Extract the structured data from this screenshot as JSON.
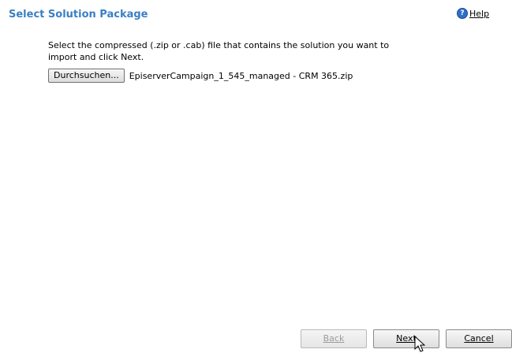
{
  "header": {
    "title": "Select Solution Package",
    "help_label": "Help",
    "help_icon": "help-icon"
  },
  "main": {
    "instructions": "Select the compressed (.zip or .cab) file that contains the solution you want to import and click Next.",
    "browse_label": "Durchsuchen...",
    "file_name": "EpiserverCampaign_1_545_managed - CRM 365.zip"
  },
  "footer": {
    "back_label": "Back",
    "next_label": "Next",
    "cancel_label": "Cancel"
  },
  "colors": {
    "title": "#3a7fc4",
    "help_icon_bg": "#2f6fc8",
    "disabled_text": "#9a9a9a"
  }
}
